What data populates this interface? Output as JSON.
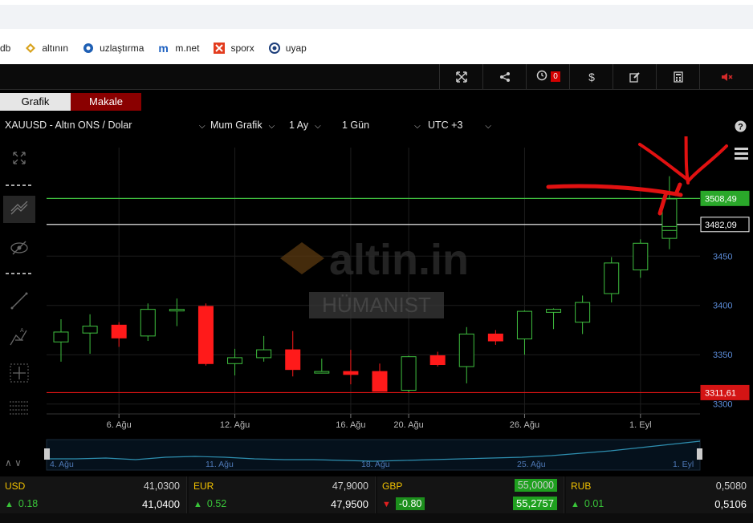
{
  "bookmarks": [
    {
      "label": "db",
      "icon": "none"
    },
    {
      "label": "altının",
      "icon": "altin-logo-icon"
    },
    {
      "label": "uzlaştırma",
      "icon": "globe-icon"
    },
    {
      "label": "m.net",
      "icon": "m-logo-icon"
    },
    {
      "label": "sporx",
      "icon": "sporx-logo-icon"
    },
    {
      "label": "uyap",
      "icon": "uyap-logo-icon"
    }
  ],
  "toolbar": {
    "alarm_count": "0",
    "icons": [
      "fullscreen-icon",
      "share-icon",
      "alarm-clock-icon",
      "dollar-icon",
      "edit-icon",
      "calculator-icon",
      "mute-icon"
    ]
  },
  "tabs": {
    "grafik": "Grafik",
    "makale": "Makale"
  },
  "selectors": {
    "symbol": "XAUUSD - Altın ONS / Dolar",
    "chart_type": "Mum Grafik",
    "range": "1 Ay",
    "interval": "1 Gün",
    "timezone": "UTC +3"
  },
  "watermark": {
    "brand": "altin.in",
    "tag": "HÜMANIST"
  },
  "price_labels": {
    "green": "3508,49",
    "white": "3482,09",
    "red": "3311,61"
  },
  "chart_data": {
    "type": "candlestick",
    "y_ticks": [
      "3450",
      "3400",
      "3350",
      "3300"
    ],
    "x_ticks": [
      "6. Ağu",
      "12. Ağu",
      "16. Ağu",
      "20. Ağu",
      "26. Ağu",
      "1. Eyl"
    ],
    "navigator_ticks": [
      "4. Ağu",
      "11. Ağu",
      "18. Ağu",
      "25. Ağu",
      "1. Eyl"
    ],
    "ylim": [
      3290,
      3560
    ],
    "hlines": [
      {
        "value": 3508.49,
        "color": "#3fbf3f"
      },
      {
        "value": 3482.09,
        "color": "#ffffff"
      },
      {
        "value": 3311.61,
        "color": "#e01515"
      }
    ],
    "candles": [
      {
        "o": 3363,
        "c": 3373,
        "h": 3386,
        "l": 3343
      },
      {
        "o": 3372,
        "c": 3379,
        "h": 3391,
        "l": 3351
      },
      {
        "o": 3380,
        "c": 3367,
        "h": 3383,
        "l": 3358
      },
      {
        "o": 3369,
        "c": 3396,
        "h": 3402,
        "l": 3364
      },
      {
        "o": 3395,
        "c": 3396,
        "h": 3407,
        "l": 3379
      },
      {
        "o": 3399,
        "c": 3341,
        "h": 3402,
        "l": 3339
      },
      {
        "o": 3341,
        "c": 3347,
        "h": 3356,
        "l": 3329
      },
      {
        "o": 3347,
        "c": 3355,
        "h": 3369,
        "l": 3343
      },
      {
        "o": 3355,
        "c": 3335,
        "h": 3374,
        "l": 3328
      },
      {
        "o": 3333,
        "c": 3333,
        "h": 3346,
        "l": 3331
      },
      {
        "o": 3333,
        "c": 3330,
        "h": 3355,
        "l": 3320
      },
      {
        "o": 3333,
        "c": 3313,
        "h": 3341,
        "l": 3313
      },
      {
        "o": 3314,
        "c": 3348,
        "h": 3349,
        "l": 3312
      },
      {
        "o": 3349,
        "c": 3340,
        "h": 3353,
        "l": 3338
      },
      {
        "o": 3338,
        "c": 3371,
        "h": 3378,
        "l": 3321
      },
      {
        "o": 3371,
        "c": 3364,
        "h": 3375,
        "l": 3360
      },
      {
        "o": 3366,
        "c": 3394,
        "h": 3395,
        "l": 3350
      },
      {
        "o": 3393,
        "c": 3396,
        "h": 3397,
        "l": 3376
      },
      {
        "o": 3383,
        "c": 3403,
        "h": 3410,
        "l": 3371
      },
      {
        "o": 3412,
        "c": 3443,
        "h": 3449,
        "l": 3403
      },
      {
        "o": 3436,
        "c": 3463,
        "h": 3467,
        "l": 3428
      },
      {
        "o": 3468,
        "c": 3508,
        "h": 3531,
        "l": 3457
      }
    ],
    "last_candle_body": [
      3476,
      3480
    ]
  },
  "currencies": [
    {
      "name": "USD",
      "ask": "41,0300",
      "change": "0.18",
      "bid": "41,0400",
      "dir": "up"
    },
    {
      "name": "EUR",
      "ask": "47,9000",
      "change": "0.52",
      "bid": "47,9500",
      "dir": "up"
    },
    {
      "name": "GBP",
      "ask": "55,0000",
      "change": "-0.80",
      "bid": "55,2757",
      "dir": "down"
    },
    {
      "name": "RUB",
      "ask": "0,5080",
      "change": "0.01",
      "bid": "0,5106",
      "dir": "up"
    }
  ]
}
